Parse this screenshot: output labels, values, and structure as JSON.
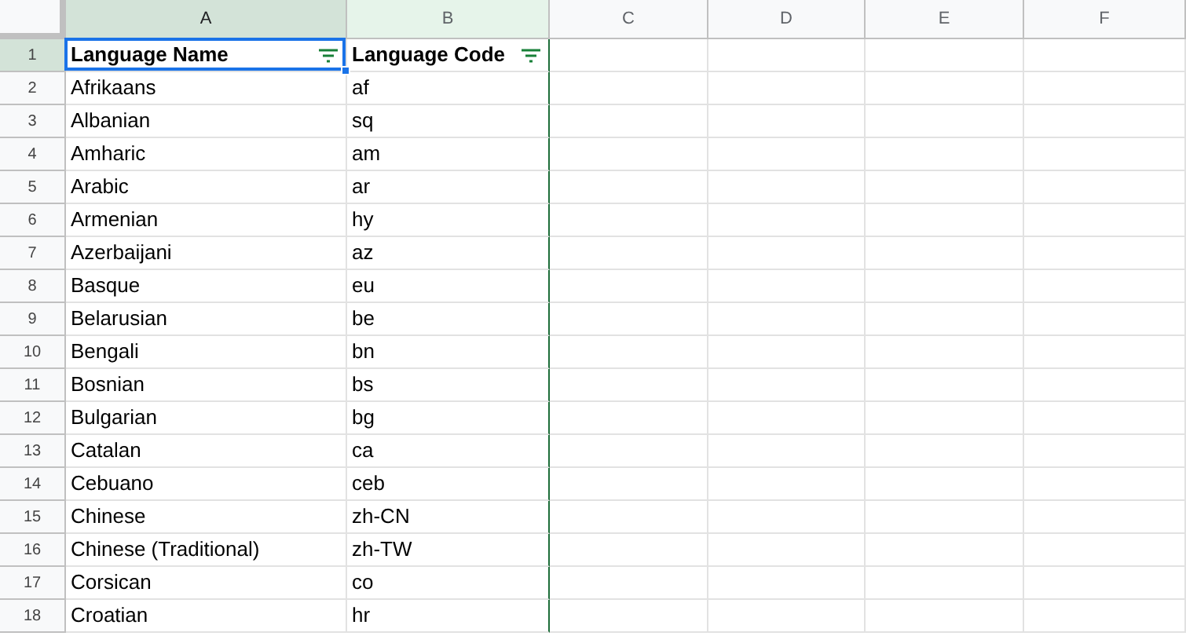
{
  "columns": [
    {
      "label": "A",
      "selected": true,
      "active": true
    },
    {
      "label": "B",
      "selected": true,
      "active": false
    },
    {
      "label": "C",
      "selected": false,
      "active": false
    },
    {
      "label": "D",
      "selected": false,
      "active": false
    },
    {
      "label": "E",
      "selected": false,
      "active": false
    },
    {
      "label": "F",
      "selected": false,
      "active": false
    }
  ],
  "rows": [
    {
      "number": "1",
      "selected": true,
      "kind": "header",
      "cells": [
        "Language Name",
        "Language Code"
      ]
    },
    {
      "number": "2",
      "selected": false,
      "kind": "data",
      "cells": [
        "Afrikaans",
        "af"
      ]
    },
    {
      "number": "3",
      "selected": false,
      "kind": "data",
      "cells": [
        "Albanian",
        "sq"
      ]
    },
    {
      "number": "4",
      "selected": false,
      "kind": "data",
      "cells": [
        "Amharic",
        "am"
      ]
    },
    {
      "number": "5",
      "selected": false,
      "kind": "data",
      "cells": [
        "Arabic",
        "ar"
      ]
    },
    {
      "number": "6",
      "selected": false,
      "kind": "data",
      "cells": [
        "Armenian",
        "hy"
      ]
    },
    {
      "number": "7",
      "selected": false,
      "kind": "data",
      "cells": [
        "Azerbaijani",
        "az"
      ]
    },
    {
      "number": "8",
      "selected": false,
      "kind": "data",
      "cells": [
        "Basque",
        "eu"
      ]
    },
    {
      "number": "9",
      "selected": false,
      "kind": "data",
      "cells": [
        "Belarusian",
        "be"
      ]
    },
    {
      "number": "10",
      "selected": false,
      "kind": "data",
      "cells": [
        "Bengali",
        "bn"
      ]
    },
    {
      "number": "11",
      "selected": false,
      "kind": "data",
      "cells": [
        "Bosnian",
        "bs"
      ]
    },
    {
      "number": "12",
      "selected": false,
      "kind": "data",
      "cells": [
        "Bulgarian",
        "bg"
      ]
    },
    {
      "number": "13",
      "selected": false,
      "kind": "data",
      "cells": [
        "Catalan",
        "ca"
      ]
    },
    {
      "number": "14",
      "selected": false,
      "kind": "data",
      "cells": [
        "Cebuano",
        "ceb"
      ]
    },
    {
      "number": "15",
      "selected": false,
      "kind": "data",
      "cells": [
        "Chinese",
        "zh-CN"
      ]
    },
    {
      "number": "16",
      "selected": false,
      "kind": "data",
      "cells": [
        "Chinese (Traditional)",
        "zh-TW"
      ]
    },
    {
      "number": "17",
      "selected": false,
      "kind": "data",
      "cells": [
        "Corsican",
        "co"
      ]
    },
    {
      "number": "18",
      "selected": false,
      "kind": "data",
      "cells": [
        "Croatian",
        "hr"
      ]
    }
  ]
}
